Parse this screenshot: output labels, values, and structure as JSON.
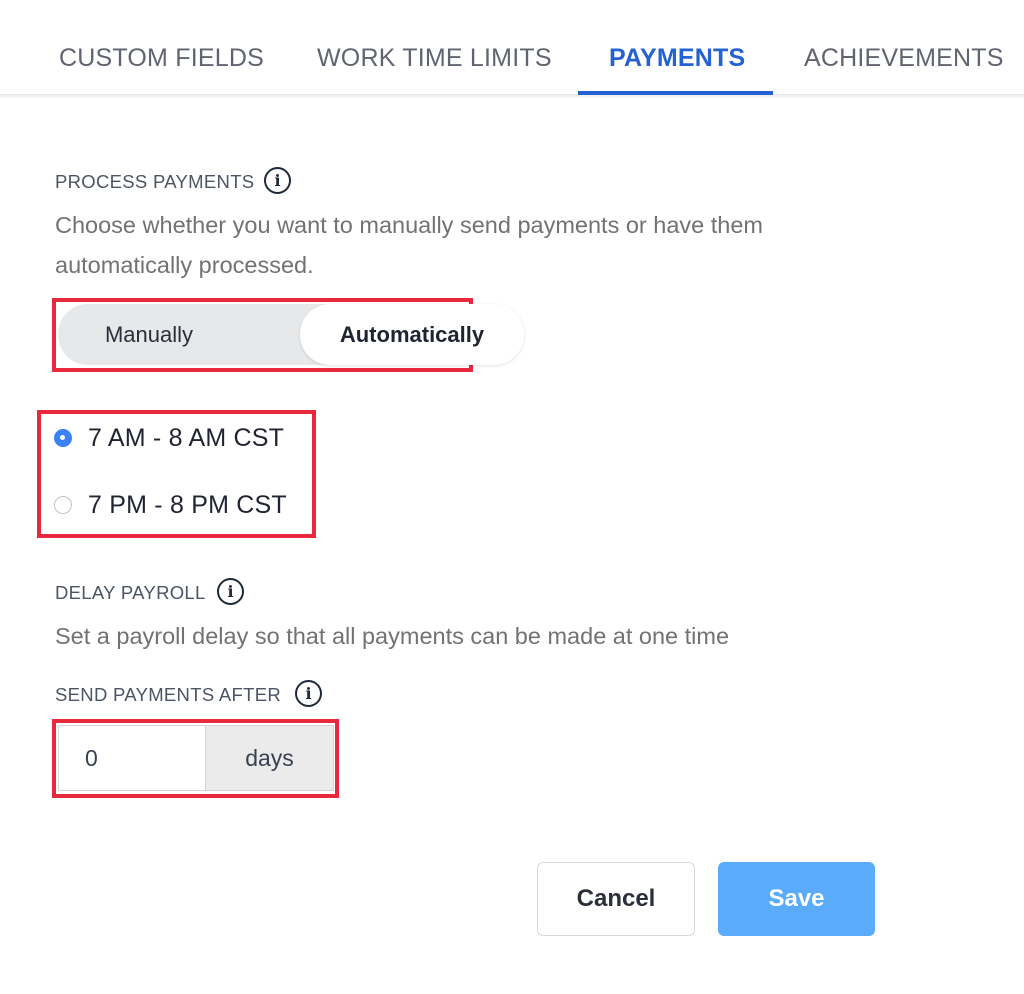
{
  "tabs": [
    {
      "label": "CUSTOM FIELDS",
      "active": false
    },
    {
      "label": "WORK TIME LIMITS",
      "active": false
    },
    {
      "label": "PAYMENTS",
      "active": true
    },
    {
      "label": "ACHIEVEMENTS",
      "active": false
    }
  ],
  "process_payments": {
    "label": "PROCESS PAYMENTS",
    "info_icon": "info-icon",
    "description": "Choose whether you want to manually send payments or have them automatically processed.",
    "toggle": {
      "options": [
        "Manually",
        "Automatically"
      ],
      "selected": "Automatically"
    },
    "time_windows": [
      {
        "label": "7 AM - 8 AM CST",
        "checked": true
      },
      {
        "label": "7 PM - 8 PM CST",
        "checked": false
      }
    ]
  },
  "delay_payroll": {
    "label": "DELAY PAYROLL",
    "info_icon": "info-icon",
    "description": "Set a payroll delay so that all payments can be made at one time"
  },
  "send_payments_after": {
    "label": "SEND PAYMENTS AFTER",
    "info_icon": "info-icon",
    "value": "0",
    "unit": "days"
  },
  "actions": {
    "cancel_label": "Cancel",
    "save_label": "Save"
  },
  "colors": {
    "accent": "#2462d4",
    "highlight": "#e8283c",
    "save_button": "#5aabf9",
    "radio_checked": "#3b82f6"
  }
}
